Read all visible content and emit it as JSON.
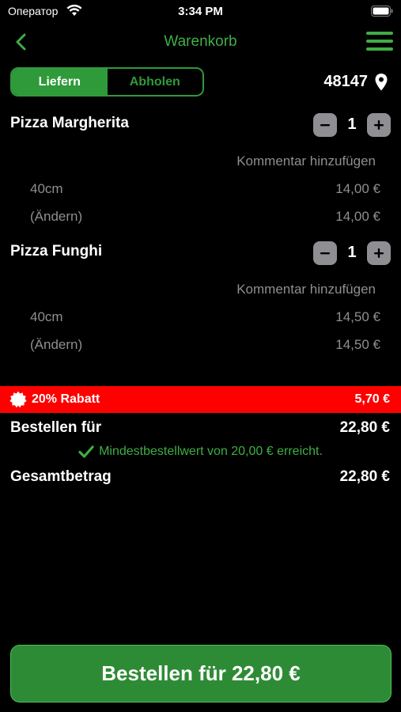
{
  "status_bar": {
    "carrier": "Оператор",
    "time": "3:34 PM"
  },
  "nav": {
    "title": "Warenkorb"
  },
  "mode_toggle": {
    "options": [
      "Liefern",
      "Abholen"
    ],
    "selected": "Liefern"
  },
  "location": {
    "zip": "48147"
  },
  "cart": {
    "items": [
      {
        "name": "Pizza Margherita",
        "quantity": "1",
        "comment_link": "Kommentar hinzufügen",
        "options": [
          {
            "label": "40cm",
            "price": "14,00 €"
          },
          {
            "label": "(Ändern)",
            "price": "14,00 €"
          }
        ]
      },
      {
        "name": "Pizza Funghi",
        "quantity": "1",
        "comment_link": "Kommentar hinzufügen",
        "options": [
          {
            "label": "40cm",
            "price": "14,50 €"
          },
          {
            "label": "(Ändern)",
            "price": "14,50 €"
          }
        ]
      }
    ]
  },
  "discount": {
    "label": "20% Rabatt",
    "amount": "5,70 €"
  },
  "summary": {
    "order_for_label": "Bestellen für",
    "order_for_value": "22,80 €",
    "min_order_text": "Mindestbestellwert von 20,00 € erreicht.",
    "total_label": "Gesamtbetrag",
    "total_value": "22,80 €"
  },
  "order_button": {
    "label": "Bestellen für 22,80 €"
  },
  "colors": {
    "accent_green": "#3fae45",
    "discount_red": "#ff0000",
    "muted_gray": "#8e8e93"
  }
}
